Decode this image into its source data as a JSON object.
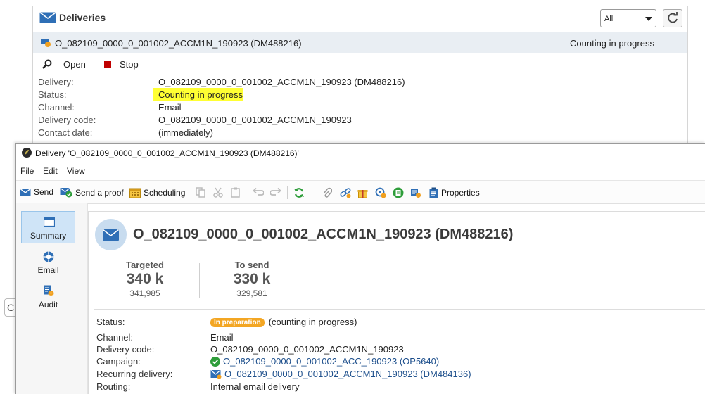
{
  "background": {
    "panel_title": "Deliveries",
    "filter_value": "All",
    "row": {
      "name": "O_082109_0000_0_001002_ACCM1N_190923 (DM488216)",
      "status": "Counting in progress"
    },
    "actions": {
      "open": "Open",
      "stop": "Stop"
    },
    "details": [
      {
        "label": "Delivery:",
        "value": "O_082109_0000_0_001002_ACCM1N_190923 (DM488216)"
      },
      {
        "label": "Status:",
        "value": "Counting in progress"
      },
      {
        "label": "Channel:",
        "value": "Email"
      },
      {
        "label": "Delivery code:",
        "value": "O_082109_0000_0_001002_ACCM1N_190923"
      },
      {
        "label": "Contact date:",
        "value": "(immediately)"
      }
    ],
    "left_button_glyph": "C"
  },
  "dialog": {
    "title": "Delivery 'O_082109_0000_0_001002_ACCM1N_190923 (DM488216)'",
    "menu": [
      "File",
      "Edit",
      "View"
    ],
    "toolbar": {
      "send": "Send",
      "send_proof": "Send a proof",
      "scheduling": "Scheduling",
      "properties": "Properties"
    },
    "sidebar": [
      {
        "label": "Summary",
        "icon": "summary-icon"
      },
      {
        "label": "Email",
        "icon": "email-icon"
      },
      {
        "label": "Audit",
        "icon": "audit-icon"
      }
    ],
    "header_title": "O_082109_0000_0_001002_ACCM1N_190923 (DM488216)",
    "kpis": [
      {
        "label": "Targeted",
        "value": "340 k",
        "exact": "341,985"
      },
      {
        "label": "To send",
        "value": "330 k",
        "exact": "329,581"
      }
    ],
    "fields": {
      "status_label": "Status:",
      "status_badge": "In preparation",
      "status_text": "(counting in progress)",
      "channel_label": "Channel:",
      "channel_value": "Email",
      "code_label": "Delivery code:",
      "code_value": "O_082109_0000_0_001002_ACCM1N_190923",
      "campaign_label": "Campaign:",
      "campaign_value": "O_082109_0000_0_001002_ACC_190923 (OP5640)",
      "recurring_label": "Recurring delivery:",
      "recurring_value": "O_082109_0000_0_001002_ACCM1N_190923 (DM484136)",
      "routing_label": "Routing:",
      "routing_value": "Internal email delivery"
    }
  },
  "colors": {
    "accent": "#1d4f8c",
    "badge": "#f3a623",
    "highlight": "#ffff33",
    "selected": "#cfe4f7"
  }
}
